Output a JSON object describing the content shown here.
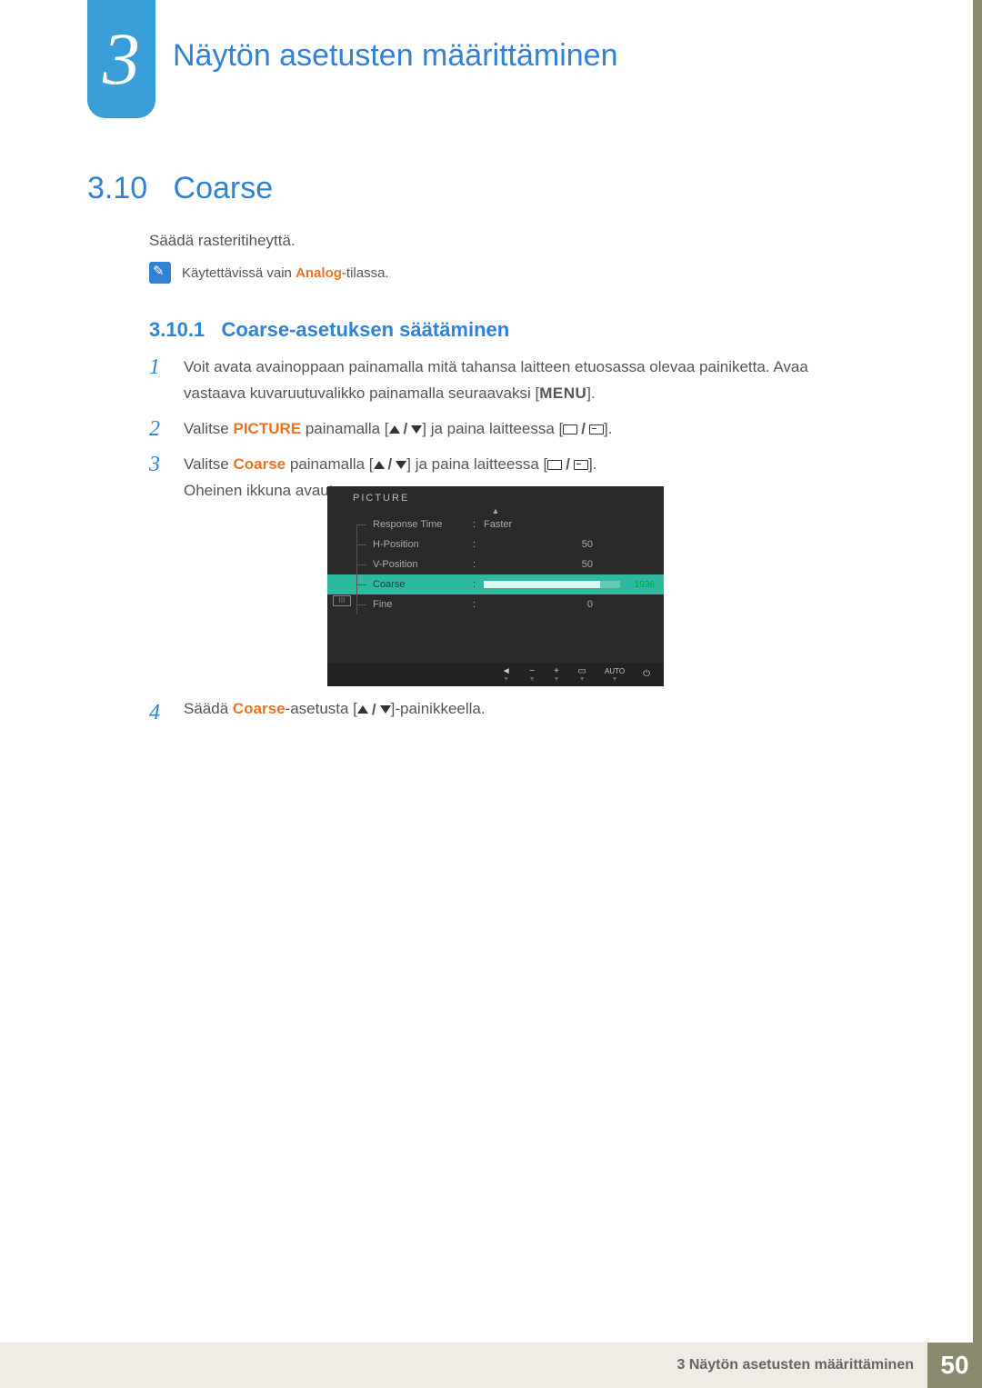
{
  "chapter": {
    "number": "3",
    "title": "Näytön asetusten määrittäminen"
  },
  "section": {
    "number": "3.10",
    "title": "Coarse"
  },
  "intro": "Säädä rasteritiheyttä.",
  "note": {
    "prefix": "Käytettävissä vain ",
    "highlight": "Analog",
    "suffix": "-tilassa."
  },
  "subsection": {
    "number": "3.10.1",
    "title": "Coarse-asetuksen säätäminen"
  },
  "steps": {
    "s1": {
      "num": "1",
      "text_a": "Voit avata avainoppaan painamalla mitä tahansa laitteen etuosassa olevaa painiketta. Avaa vastaava kuvaruutuvalikko painamalla seuraavaksi [",
      "menu": "MENU",
      "text_b": "]."
    },
    "s2": {
      "num": "2",
      "a": "Valitse ",
      "hl": "PICTURE",
      "b": " painamalla [",
      "c": "] ja paina laitteessa [",
      "d": "]."
    },
    "s3": {
      "num": "3",
      "a": "Valitse ",
      "hl": "Coarse",
      "b": " painamalla [",
      "c": "] ja paina laitteessa [",
      "d": "].",
      "e": "Oheinen ikkuna avautuu."
    },
    "s4": {
      "num": "4",
      "a": "Säädä ",
      "hl": "Coarse",
      "b": "-asetusta [",
      "c": "]-painikkeella."
    }
  },
  "osd": {
    "title": "PICTURE",
    "rows": {
      "r1": {
        "label": "Response Time",
        "value": "Faster"
      },
      "r2": {
        "label": "H-Position",
        "value": "50"
      },
      "r3": {
        "label": "V-Position",
        "value": "50"
      },
      "r4": {
        "label": "Coarse",
        "value": "1936"
      },
      "r5": {
        "label": "Fine",
        "value": "0"
      }
    },
    "side_label": "III",
    "bottom": {
      "b1": "◄",
      "b2": "−",
      "b3": "+",
      "b4": "▭",
      "b5": "AUTO",
      "b6": "⏻"
    }
  },
  "footer": {
    "text": "3 Näytön asetusten määrittäminen",
    "page": "50"
  }
}
